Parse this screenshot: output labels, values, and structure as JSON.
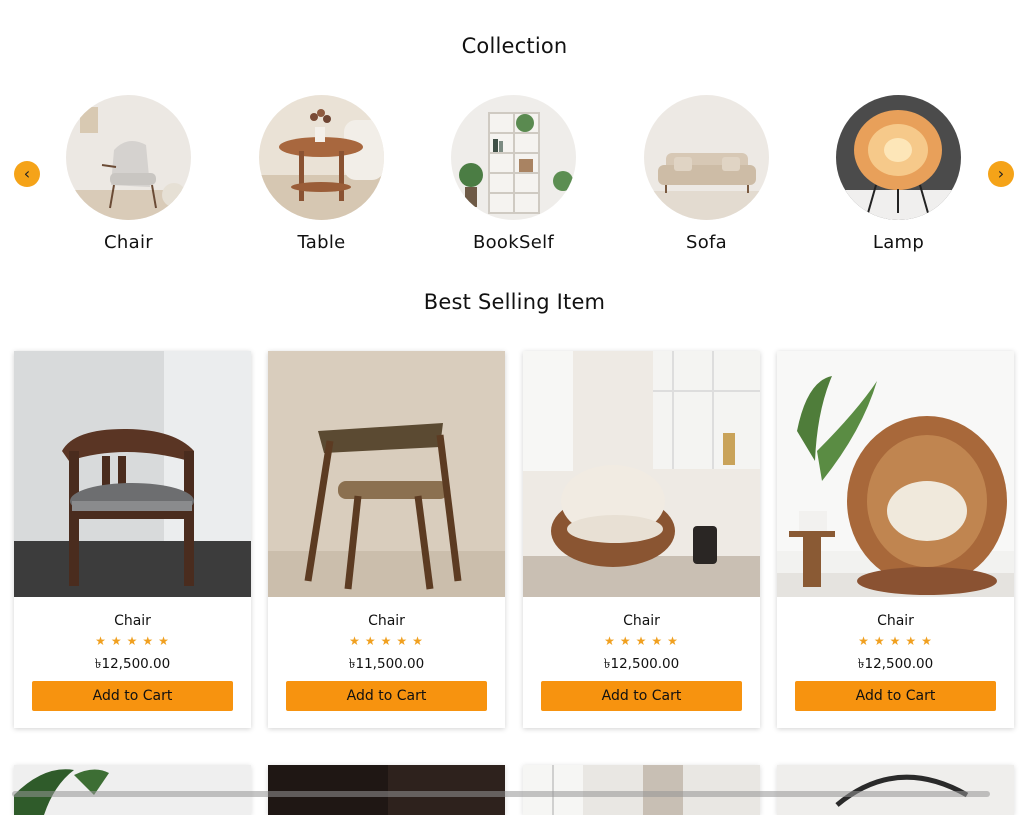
{
  "collection": {
    "title": "Collection",
    "prev_icon": "‹",
    "next_icon": "›",
    "items": [
      {
        "label": "Chair"
      },
      {
        "label": "Table"
      },
      {
        "label": "BookSelf"
      },
      {
        "label": "Sofa"
      },
      {
        "label": "Lamp"
      }
    ]
  },
  "best_selling": {
    "title": "Best Selling Item",
    "products": [
      {
        "name": "Chair",
        "rating": 5,
        "stars": "★★★★★",
        "price": "৳12,500.00",
        "button": "Add to Cart"
      },
      {
        "name": "Chair",
        "rating": 5,
        "stars": "★★★★★",
        "price": "৳11,500.00",
        "button": "Add to Cart"
      },
      {
        "name": "Chair",
        "rating": 5,
        "stars": "★★★★★",
        "price": "৳12,500.00",
        "button": "Add to Cart"
      },
      {
        "name": "Chair",
        "rating": 5,
        "stars": "★★★★★",
        "price": "৳12,500.00",
        "button": "Add to Cart"
      }
    ]
  },
  "colors": {
    "accent": "#f7930f",
    "nav_button": "#f5a318",
    "star": "#f0a020"
  }
}
